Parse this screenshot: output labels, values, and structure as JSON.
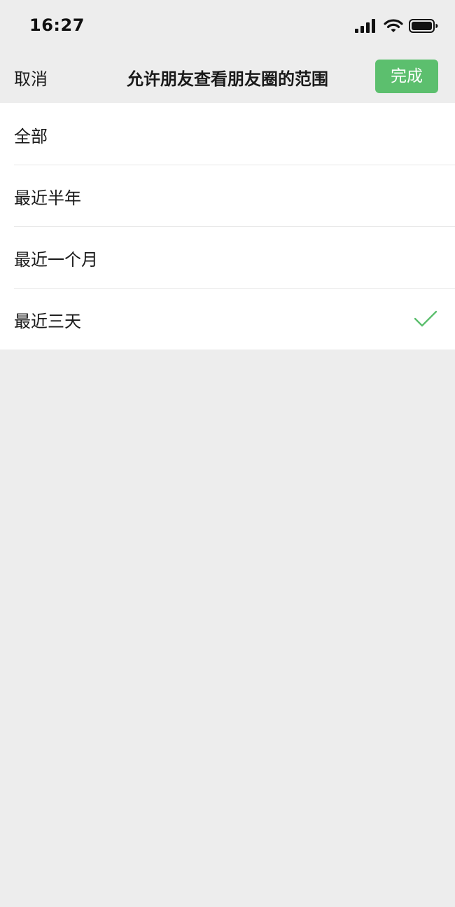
{
  "status_bar": {
    "time": "16:27",
    "icons": [
      "signal-icon",
      "wifi-icon",
      "battery-icon"
    ]
  },
  "nav": {
    "cancel_label": "取消",
    "title": "允许朋友查看朋友圈的范围",
    "done_label": "完成"
  },
  "options": [
    {
      "label": "全部",
      "selected": false
    },
    {
      "label": "最近半年",
      "selected": false
    },
    {
      "label": "最近一个月",
      "selected": false
    },
    {
      "label": "最近三天",
      "selected": true
    }
  ],
  "colors": {
    "accent": "#5cbf6e",
    "background": "#ededed",
    "list_background": "#ffffff"
  }
}
